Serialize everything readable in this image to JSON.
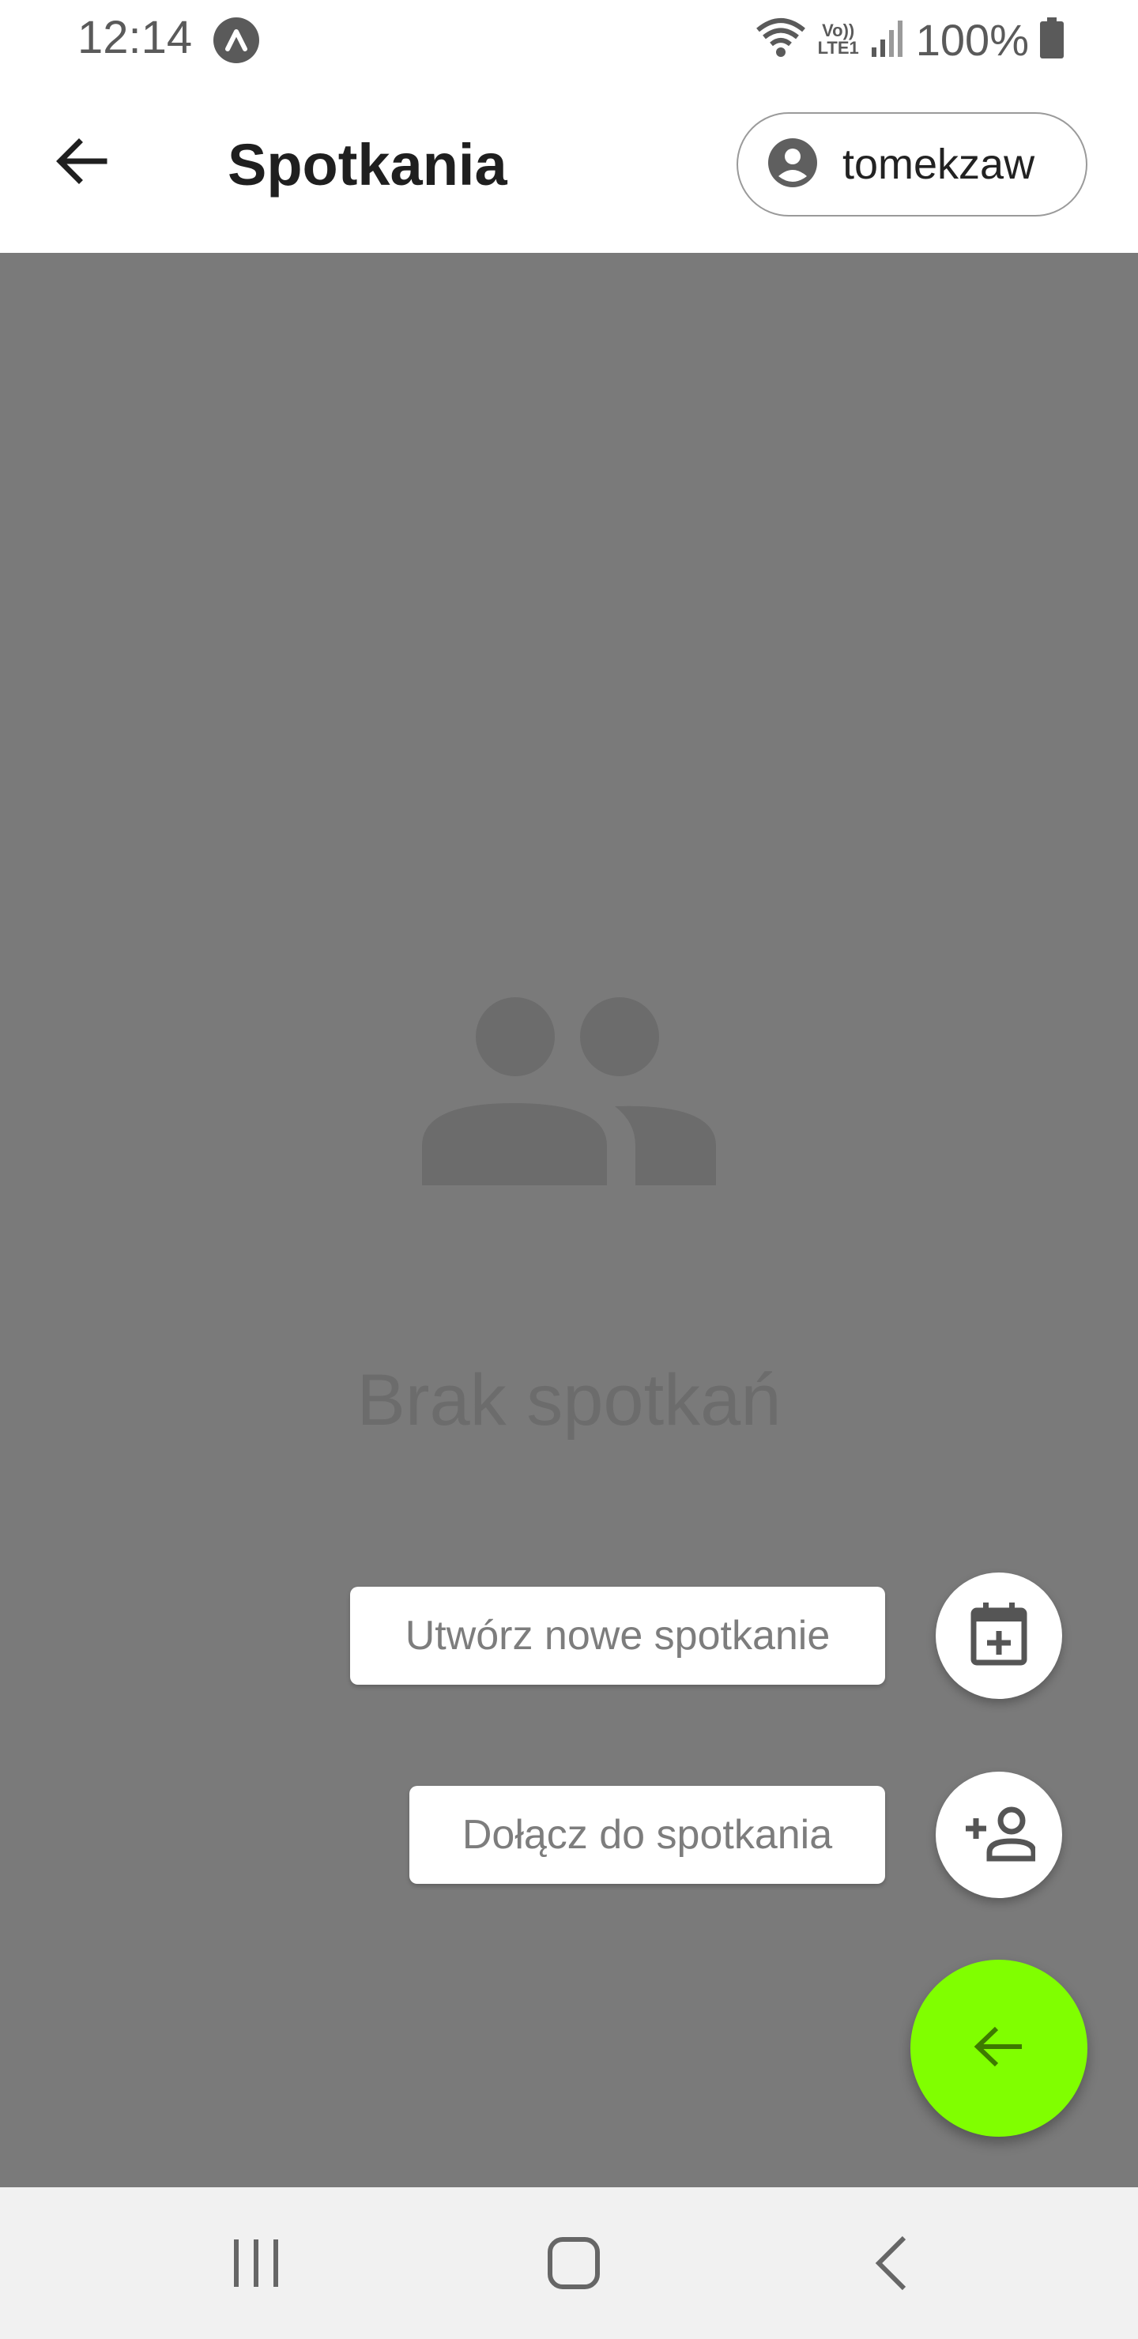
{
  "status_bar": {
    "time": "12:14",
    "signal_label_top": "Vo))",
    "signal_label_bottom": "LTE1",
    "battery": "100%"
  },
  "app_bar": {
    "title": "Spotkania",
    "user_chip_label": "tomekzaw",
    "back_icon": "arrow-back-icon",
    "user_icon": "account-circle-icon"
  },
  "main": {
    "empty_icon": "people-icon",
    "empty_text": "Brak spotkań",
    "overlay_color": "#7a7a7a"
  },
  "actions": {
    "create_label": "Utwórz nowe spotkanie",
    "create_icon": "calendar-add-icon",
    "join_label": "Dołącz do spotkania",
    "join_icon": "person-add-icon",
    "main_fab_icon": "arrow-back-icon",
    "main_fab_color": "#80ff00"
  },
  "nav_bar": {
    "recents_icon": "recents-icon",
    "home_icon": "home-icon",
    "back_icon": "chevron-left-icon"
  }
}
